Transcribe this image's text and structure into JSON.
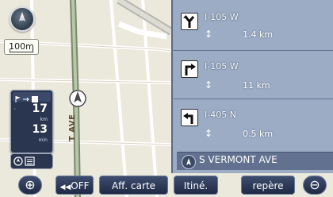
{
  "map": {
    "street_vertical_label": "T AVE"
  },
  "scale": {
    "label": "100m"
  },
  "info_panel": {
    "value_top": "17",
    "unit_top": "km",
    "value_bottom": "13",
    "unit_bottom": "min"
  },
  "guidance": {
    "rows": [
      {
        "road": "I-105 W",
        "distance": "1.4 km",
        "icon": "fork-left-icon"
      },
      {
        "road": "I-105 W",
        "distance": "11 km",
        "icon": "bear-right-icon"
      },
      {
        "road": "I-405 N",
        "distance": "0.5 km",
        "icon": "turn-left-icon"
      }
    ],
    "current_street": "S VERMONT AVE"
  },
  "toolbar": {
    "zoom_in": "⊕",
    "off": "OFF",
    "aff_carte": "Aff. carte",
    "itine": "Itiné.",
    "repere": "repère",
    "zoom_out": "⊖"
  },
  "colors": {
    "panel_bg": "#96a6c2",
    "button_bg": "#2a3550",
    "map_bg": "#e9e6da"
  }
}
